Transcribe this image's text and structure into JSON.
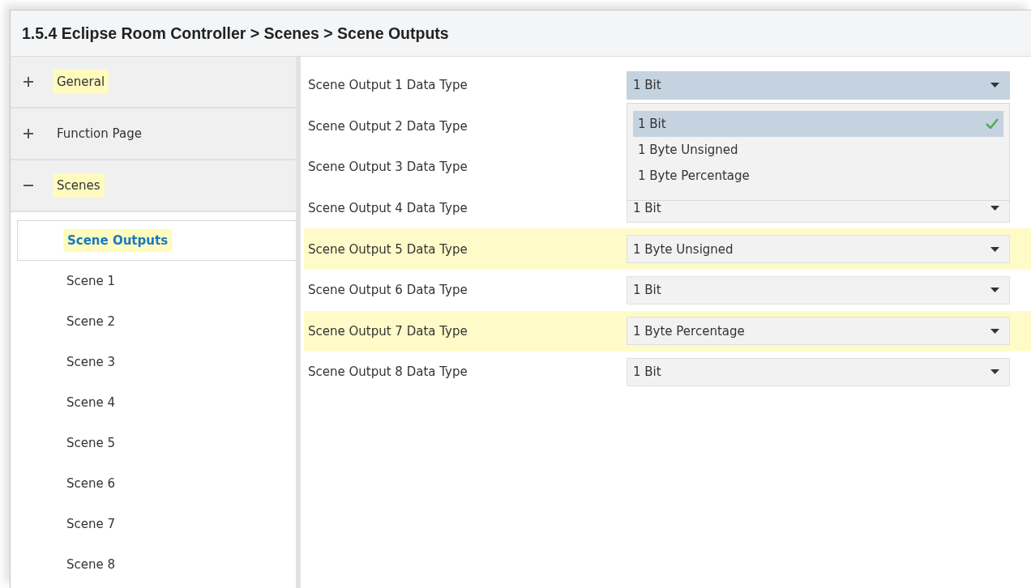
{
  "window": {
    "title": "1.5.4 Eclipse Room Controller > Scenes > Scene Outputs"
  },
  "sidebar": {
    "items": [
      {
        "label": "General",
        "kind": "group",
        "expanded": false,
        "highlighted": true
      },
      {
        "label": "Function Page",
        "kind": "group",
        "expanded": false,
        "highlighted": false
      },
      {
        "label": "Scenes",
        "kind": "group",
        "expanded": true,
        "highlighted": true,
        "children": [
          {
            "label": "Scene Outputs",
            "selected": true,
            "highlighted": true
          },
          {
            "label": "Scene 1",
            "selected": false,
            "highlighted": false
          },
          {
            "label": "Scene 2",
            "selected": false,
            "highlighted": false
          },
          {
            "label": "Scene 3",
            "selected": false,
            "highlighted": false
          },
          {
            "label": "Scene 4",
            "selected": false,
            "highlighted": false
          },
          {
            "label": "Scene 5",
            "selected": false,
            "highlighted": false
          },
          {
            "label": "Scene 6",
            "selected": false,
            "highlighted": false
          },
          {
            "label": "Scene 7",
            "selected": false,
            "highlighted": false
          },
          {
            "label": "Scene 8",
            "selected": false,
            "highlighted": false
          }
        ]
      }
    ]
  },
  "parameters": [
    {
      "label": "Scene Output 1 Data Type",
      "value": "1 Bit",
      "highlighted": false,
      "open": true,
      "options": [
        {
          "label": "1 Bit",
          "selected": true
        },
        {
          "label": "1 Byte Unsigned",
          "selected": false
        },
        {
          "label": "1 Byte Percentage",
          "selected": false
        }
      ]
    },
    {
      "label": "Scene Output 2 Data Type",
      "highlighted": false
    },
    {
      "label": "Scene Output 3 Data Type",
      "highlighted": false
    },
    {
      "label": "Scene Output 4 Data Type",
      "value": "1 Bit",
      "highlighted": false,
      "open": false
    },
    {
      "label": "Scene Output 5 Data Type",
      "value": "1 Byte Unsigned",
      "highlighted": true,
      "open": false
    },
    {
      "label": "Scene Output 6 Data Type",
      "value": "1 Bit",
      "highlighted": false,
      "open": false
    },
    {
      "label": "Scene Output 7 Data Type",
      "value": "1 Byte Percentage",
      "highlighted": true,
      "open": false
    },
    {
      "label": "Scene Output 8 Data Type",
      "value": "1 Bit",
      "highlighted": false,
      "open": false
    }
  ]
}
